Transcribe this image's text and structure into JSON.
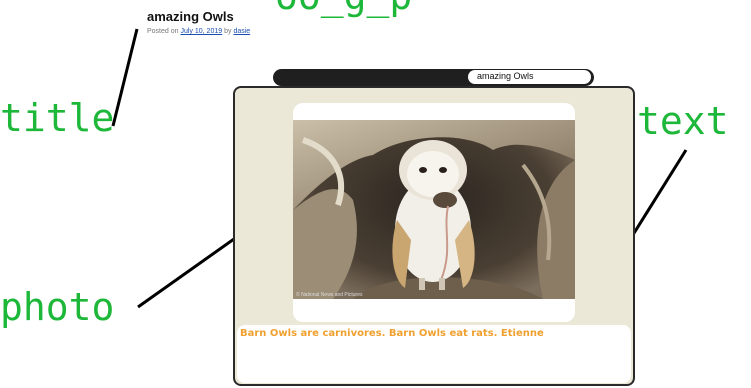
{
  "post": {
    "title": "amazing Owls",
    "meta_prefix": "Posted on",
    "date": "July 10, 2019",
    "by": "by",
    "author": "dasie"
  },
  "annotations": {
    "title": "title",
    "text": "text",
    "photo": "photo",
    "top_cut": "oo_g_p"
  },
  "slideshow": {
    "window_title": "amazing Owls",
    "photo_credit": "© National News and Pictures",
    "caption": "Barn Owls are carnivores. Barn Owls eat rats. Etienne"
  },
  "colors": {
    "annotation": "#1db83a",
    "caption": "#f0a02e",
    "frame_bg": "#ece8d7",
    "bar": "#1f1f1f"
  }
}
